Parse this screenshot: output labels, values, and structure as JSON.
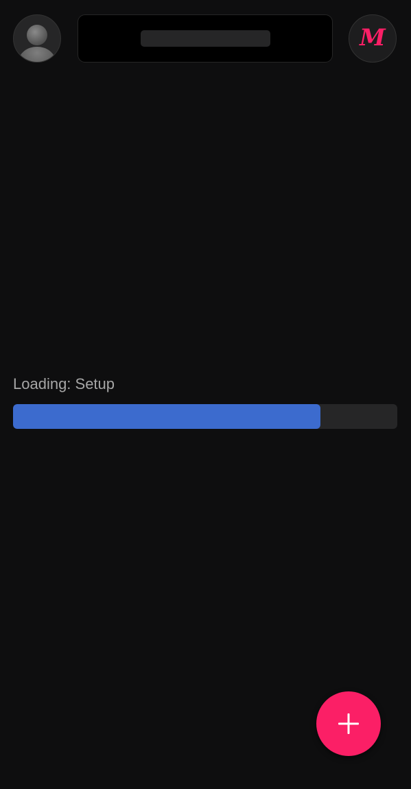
{
  "header": {
    "avatar_icon": "user-avatar-icon",
    "search_icon": "search-placeholder",
    "brand_icon": "m-logo-icon",
    "brand_letter": "M"
  },
  "loading": {
    "label": "Loading: Setup",
    "progress_fraction": 0.8
  },
  "fab": {
    "icon": "plus-icon"
  },
  "colors": {
    "background": "#0e0e0f",
    "brand_accent": "#fb1f66",
    "progress_fill": "#3c6bce",
    "progress_track": "#262627",
    "label_text": "#a6a6a6"
  }
}
